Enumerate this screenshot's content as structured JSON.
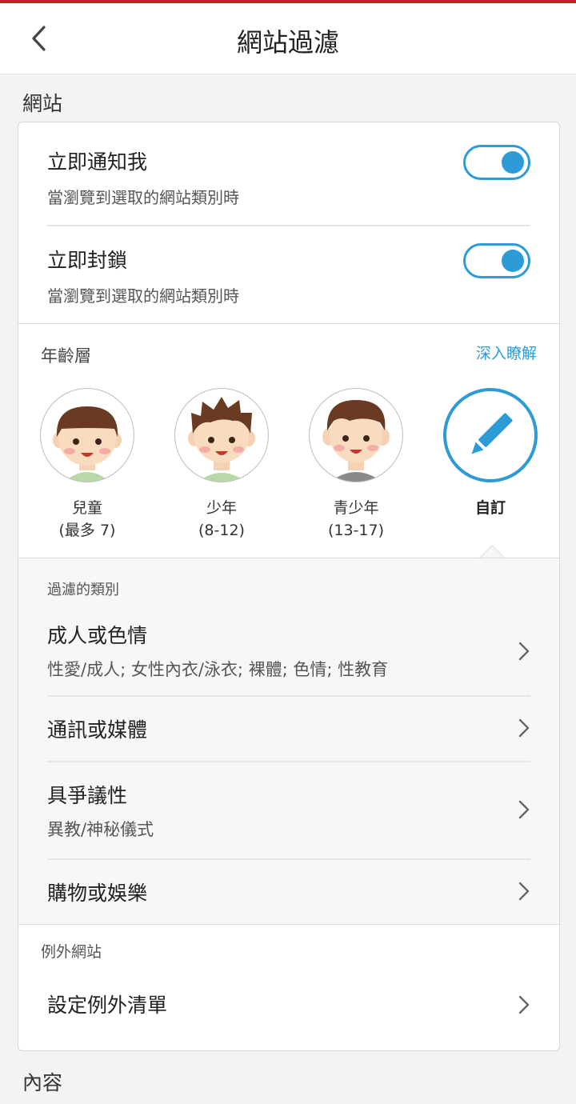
{
  "header": {
    "title": "網站過濾"
  },
  "sections": {
    "website": "網站",
    "content": "內容"
  },
  "toggles": [
    {
      "title": "立即通知我",
      "subtitle": "當瀏覽到選取的網站類別時",
      "on": true
    },
    {
      "title": "立即封鎖",
      "subtitle": "當瀏覽到選取的網站類別時",
      "on": true
    }
  ],
  "age": {
    "label": "年齡層",
    "learn_more": "深入瞭解",
    "options": [
      {
        "name": "兒童",
        "range": "(最多 7)"
      },
      {
        "name": "少年",
        "range": "(8-12)"
      },
      {
        "name": "青少年",
        "range": "(13-17)"
      },
      {
        "name": "自訂",
        "range": "",
        "selected": true
      }
    ]
  },
  "filters": {
    "heading": "過濾的類別",
    "categories": [
      {
        "title": "成人或色情",
        "subtitle": "性愛/成人; 女性內衣/泳衣; 裸體; 色情; 性教育"
      },
      {
        "title": "通訊或媒體",
        "subtitle": ""
      },
      {
        "title": "具爭議性",
        "subtitle": "異教/神秘儀式"
      },
      {
        "title": "購物或娛樂",
        "subtitle": ""
      }
    ]
  },
  "exceptions": {
    "label": "例外網站",
    "item": "設定例外清單"
  },
  "colors": {
    "accent": "#2c9bd6",
    "topline": "#c8202b"
  }
}
